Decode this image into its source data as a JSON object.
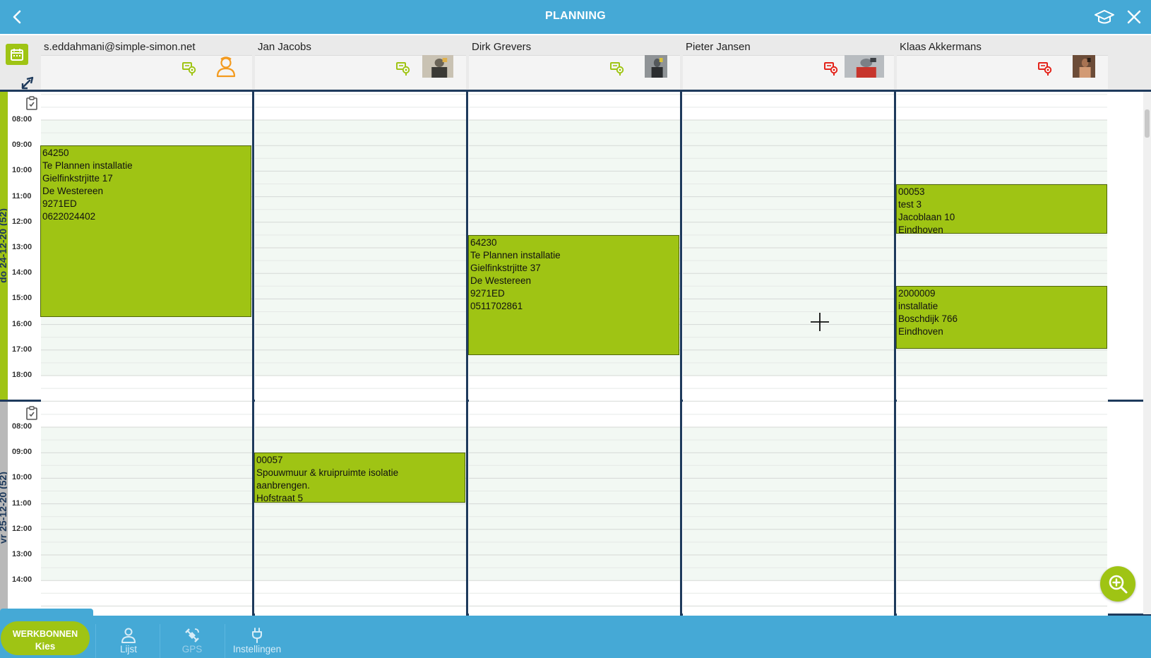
{
  "title": "PLANNING",
  "employees": [
    {
      "name": "s.eddahmani@simple-simon.net",
      "route": "green",
      "avatar": "person-outline"
    },
    {
      "name": "Jan Jacobs",
      "route": "green",
      "avatar": "photo"
    },
    {
      "name": "Dirk Grevers",
      "route": "green",
      "avatar": "photo"
    },
    {
      "name": "Pieter Jansen",
      "route": "red",
      "avatar": "photo"
    },
    {
      "name": "Klaas Akkermans",
      "route": "red",
      "avatar": "photo"
    }
  ],
  "days": [
    {
      "label": "do 24-12-20 (52)",
      "times": [
        "08:00",
        "09:00",
        "10:00",
        "11:00",
        "12:00",
        "13:00",
        "14:00",
        "15:00",
        "16:00",
        "17:00",
        "18:00"
      ],
      "events": [
        {
          "col": 0,
          "start": 9.0,
          "end": 15.7,
          "lines": [
            "64250",
            "Te Plannen installatie",
            "Gielfinkstrjitte 17",
            "De Westereen",
            "9271ED",
            "0622024402"
          ]
        },
        {
          "col": 2,
          "start": 12.5,
          "end": 17.2,
          "lines": [
            "64230",
            "Te Plannen installatie",
            "Gielfinkstrjitte 37",
            "De Westereen",
            "9271ED",
            "0511702861"
          ]
        },
        {
          "col": 4,
          "start": 10.5,
          "end": 12.45,
          "lines": [
            "00053",
            "test 3",
            "Jacoblaan 10",
            "Eindhoven"
          ]
        },
        {
          "col": 4,
          "start": 14.5,
          "end": 16.95,
          "lines": [
            "2000009",
            "installatie",
            "Boschdijk 766",
            "Eindhoven"
          ]
        }
      ]
    },
    {
      "label": "vr 25-12-20 (52)",
      "times": [
        "08:00",
        "09:00",
        "10:00",
        "11:00",
        "12:00",
        "13:00",
        "14:00"
      ],
      "events": [
        {
          "col": 1,
          "start": 9.0,
          "end": 10.95,
          "lines": [
            "00057",
            "Spouwmuur & kruipruimte isolatie",
            "aanbrengen.",
            "Hofstraat 5"
          ]
        }
      ]
    }
  ],
  "bottom": {
    "werkbonnen": "WERKBONNEN",
    "kies": "Kies",
    "lijst": "Lijst",
    "gps": "GPS",
    "instellingen": "Instellingen"
  },
  "colors": {
    "header": "#45a9d6",
    "accent": "#9fc414",
    "divider": "#1e3a5c",
    "route_green": "#9fc414",
    "route_red": "#e32219",
    "avatar_orange": "#f39a1e"
  },
  "icons": {
    "back": "chevron-left-icon",
    "graduation": "graduation-cap-icon",
    "close": "close-icon",
    "calendar": "calendar-icon",
    "swap": "swap-arrows-icon",
    "checklist": "clipboard-check-icon",
    "zoom": "zoom-in-icon",
    "lijst": "person-icon",
    "gps": "satellite-icon",
    "instellingen": "plug-icon"
  }
}
